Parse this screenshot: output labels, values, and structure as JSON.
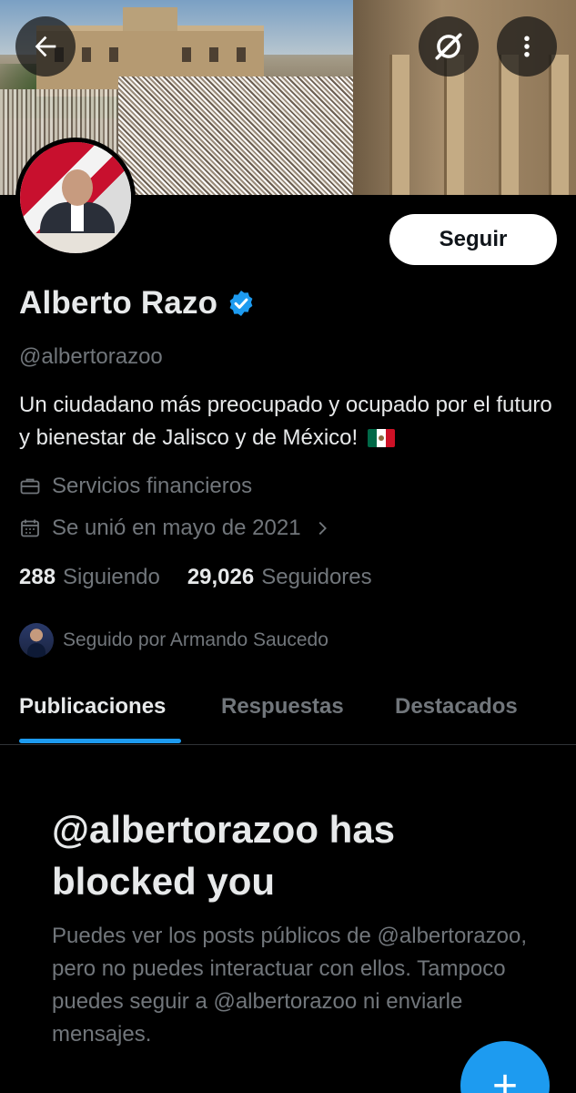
{
  "header": {
    "back_icon": "arrow-left-icon",
    "grok_icon": "grok-icon",
    "more_icon": "more-vertical-icon"
  },
  "profile": {
    "name": "Alberto Razo",
    "verified": true,
    "handle": "@albertorazoo",
    "bio": "Un ciudadano más preocupado y ocupado por el futuro y bienestar de Jalisco y de México!",
    "bio_emoji": "mexico-flag",
    "category": "Servicios financieros",
    "joined": "Se unió en mayo de 2021",
    "following_count": "288",
    "following_label": "Siguiendo",
    "followers_count": "29,026",
    "followers_label": "Seguidores",
    "followed_by": "Seguido por Armando Saucedo",
    "follow_button": "Seguir"
  },
  "tabs": [
    {
      "label": "Publicaciones",
      "active": true
    },
    {
      "label": "Respuestas",
      "active": false
    },
    {
      "label": "Destacados",
      "active": false
    }
  ],
  "blocked": {
    "title": "@albertorazoo has blocked you",
    "text": "Puedes ver los posts públicos de @albertorazoo, pero no puedes interactuar con ellos. Tampoco puedes seguir a @albertorazoo ni enviarle mensajes."
  },
  "fab": {
    "label": "+"
  },
  "colors": {
    "accent": "#1d9bf0",
    "background": "#000000",
    "text": "#e7e9ea",
    "muted": "#71767b"
  }
}
